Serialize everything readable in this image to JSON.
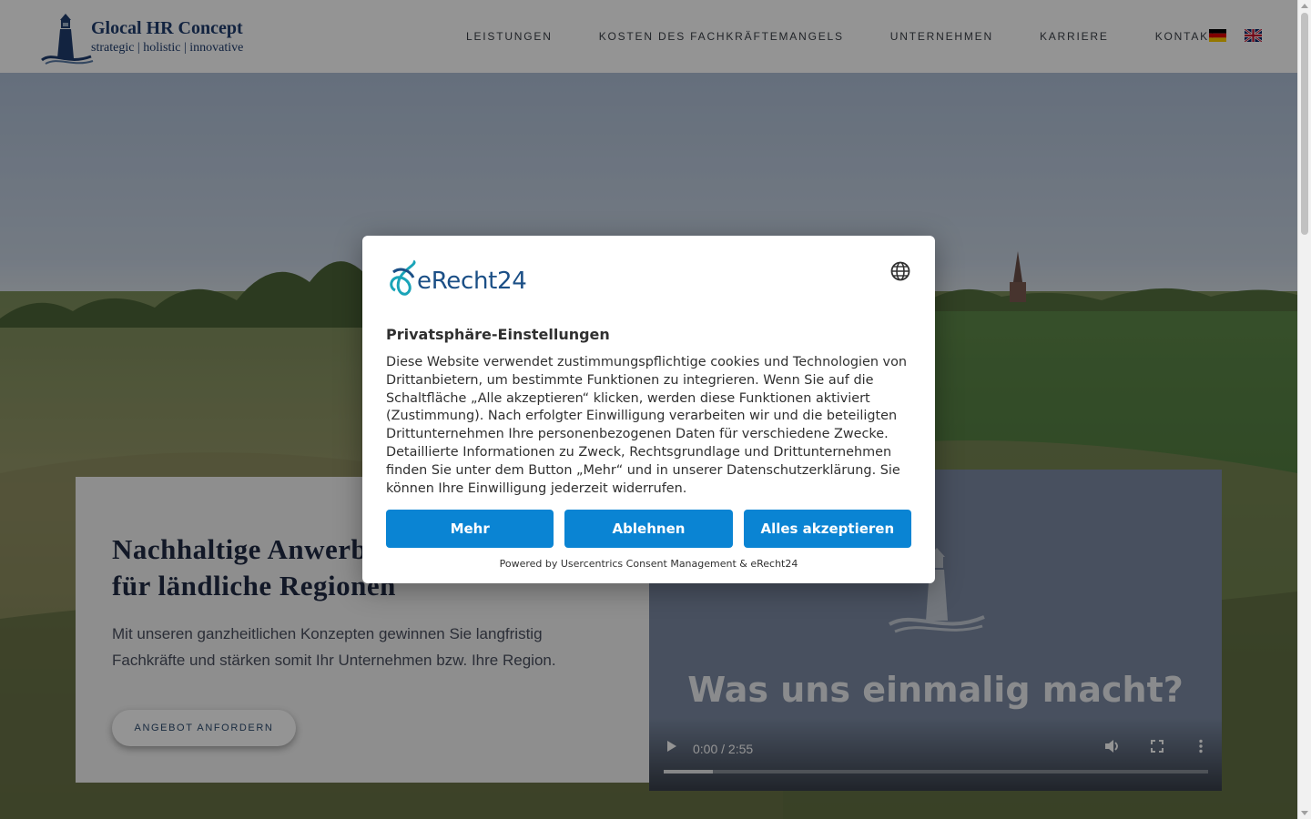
{
  "header": {
    "logo_title": "Glocal HR Concept",
    "logo_subtitle": "strategic | holistic | innovative",
    "nav": [
      "LEISTUNGEN",
      "KOSTEN DES FACHKRÄFTEMANGELS",
      "UNTERNEHMEN",
      "KARRIERE",
      "KONTAKT"
    ],
    "languages": [
      "de",
      "en"
    ]
  },
  "hero": {
    "title": "Nachhaltige Anwerbung von Fachkräften für ländliche Regionen",
    "text": "Mit unseren ganzheitlichen Konzepten gewinnen Sie langfristig Fachkräfte und stärken somit Ihr Unternehmen bzw. Ihre Region.",
    "cta_label": "ANGEBOT ANFORDERN"
  },
  "video": {
    "heading": "Was uns einmalig macht?",
    "time": "0:00 / 2:55",
    "buffered_fraction": 0.09
  },
  "consent": {
    "brand": "eRecht24",
    "title": "Privatsphäre-Einstellungen",
    "text": "Diese Website verwendet zustimmungspflichtige cookies und Technologien von Drittanbietern, um bestimmte Funktionen zu integrieren. Wenn Sie auf die Schaltfläche „Alle akzeptieren“ klicken, werden diese Funktionen aktiviert (Zustimmung). Nach erfolgter Einwilligung verarbeiten wir und die beteiligten Drittunternehmen Ihre personenbezogenen Daten für verschiedene Zwecke. Detaillierte Informationen zu Zweck, Rechtsgrundlage und Drittunternehmen finden Sie unter dem Button „Mehr“ und in unserer Datenschutzerklärung. Sie können Ihre Einwilligung jederzeit widerrufen.",
    "btn_more": "Mehr",
    "btn_decline": "Ablehnen",
    "btn_accept": "Alles akzeptieren",
    "powered_by": "Powered by Usercentrics Consent Management & eRecht24"
  },
  "colors": {
    "accent_button": "#0a84d3",
    "brand_navy": "#1f3d6e",
    "overlay": "rgba(0,0,0,0.42)"
  },
  "icons": [
    "lighthouse-logo-icon",
    "globe-icon",
    "flag-de-icon",
    "flag-en-icon",
    "play-icon",
    "volume-icon",
    "fullscreen-icon",
    "more-vert-icon"
  ]
}
